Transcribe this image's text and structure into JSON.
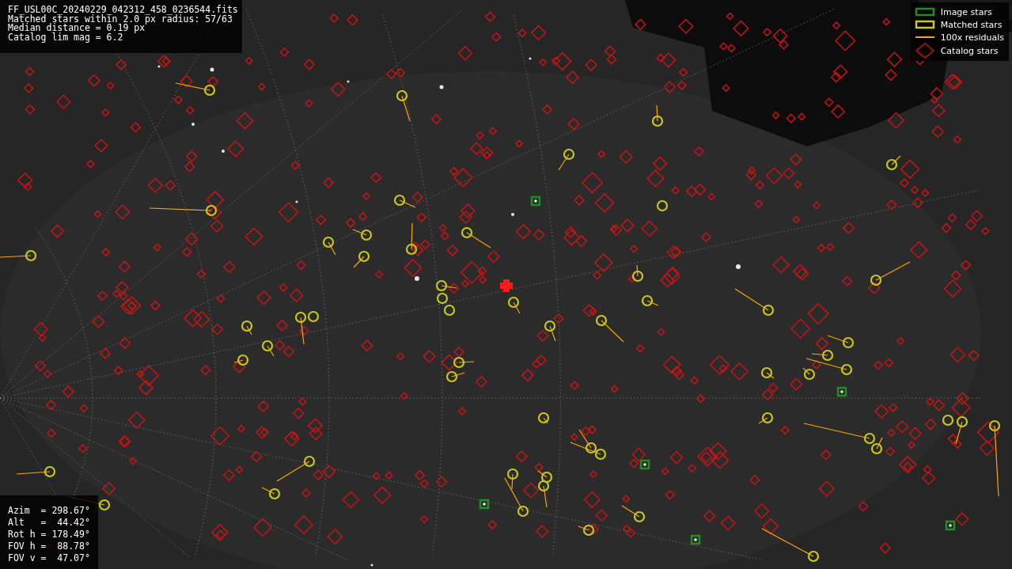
{
  "info_lines": [
    "FF_USL00C_20240229_042312_458_0236544.fits",
    "Matched stars within 2.0 px radius: 57/63",
    "Median distance = 0.19 px",
    "Catalog lim mag = 6.2"
  ],
  "legend": [
    {
      "label": "Image stars",
      "color": "#1e8f1e"
    },
    {
      "kind": "matched",
      "label": "Matched stars",
      "color": "#c8c81e"
    },
    {
      "kind": "residual",
      "label": "100x residuals",
      "color": "#ffa500"
    },
    {
      "kind": "catalog",
      "label": "Catalog stars",
      "color": "#c81414"
    }
  ],
  "pointing": [
    "Azim  = 298.67°",
    "Alt   =  44.42°",
    "Rot h = 178.49°",
    "FOV h =  88.78°",
    "FOV v =  47.07°"
  ],
  "sky": {
    "kind": "picture"
  }
}
